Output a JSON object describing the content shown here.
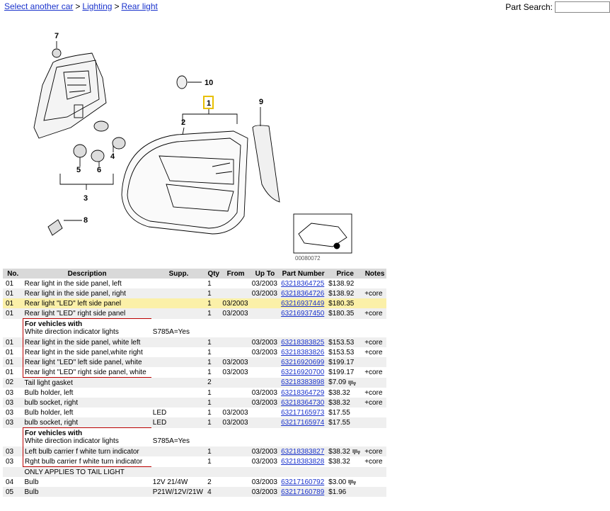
{
  "breadcrumb": {
    "items": [
      "Select another car",
      "Lighting",
      "Rear light"
    ],
    "separator": ">"
  },
  "search": {
    "label": "Part Search:",
    "value": ""
  },
  "diagram": {
    "callouts": [
      "7",
      "10",
      "1",
      "9",
      "2",
      "5",
      "6",
      "4",
      "3",
      "8"
    ],
    "thumb_code": "00080072"
  },
  "table": {
    "headers": [
      "No.",
      "Description",
      "Supp.",
      "Qty",
      "From",
      "Up To",
      "Part Number",
      "Price",
      "Notes"
    ],
    "rows": [
      {
        "no": "01",
        "desc": "Rear light in the side panel, left",
        "supp": "",
        "qty": "1",
        "from": "",
        "upto": "03/2003",
        "pn": "63218364725",
        "price": "$138.92",
        "notes": ""
      },
      {
        "no": "01",
        "desc": "Rear light in the side panel, right",
        "supp": "",
        "qty": "1",
        "from": "",
        "upto": "03/2003",
        "pn": "63218364726",
        "price": "$138.92",
        "notes": "+core"
      },
      {
        "no": "01",
        "desc": "Rear light \"LED\" left side panel",
        "supp": "",
        "qty": "1",
        "from": "03/2003",
        "upto": "",
        "pn": "63216937449",
        "price": "$180.35",
        "notes": ""
      },
      {
        "no": "01",
        "desc": "Rear light \"LED\" right side panel",
        "supp": "",
        "qty": "1",
        "from": "03/2003",
        "upto": "",
        "pn": "63216937450",
        "price": "$180.35",
        "notes": "+core"
      },
      {
        "note_title": "For vehicles with",
        "note_text": "White direction indicator lights",
        "note_code": "S785A=Yes"
      },
      {
        "no": "01",
        "desc": "Rear light in the side panel, white left",
        "supp": "",
        "qty": "1",
        "from": "",
        "upto": "03/2003",
        "pn": "63218383825",
        "price": "$153.53",
        "notes": "+core"
      },
      {
        "no": "01",
        "desc": "Rear light in the side panel,white right",
        "supp": "",
        "qty": "1",
        "from": "",
        "upto": "03/2003",
        "pn": "63218383826",
        "price": "$153.53",
        "notes": "+core"
      },
      {
        "no": "01",
        "desc": "Rear light \"LED\" left side panel, white",
        "supp": "",
        "qty": "1",
        "from": "03/2003",
        "upto": "",
        "pn": "63216920699",
        "price": "$199.17",
        "notes": ""
      },
      {
        "no": "01",
        "desc": "Rear light \"LED\" right side panel, white",
        "supp": "",
        "qty": "1",
        "from": "03/2003",
        "upto": "",
        "pn": "63216920700",
        "price": "$199.17",
        "notes": "+core"
      },
      {
        "no": "02",
        "desc": "Tail light gasket",
        "supp": "",
        "qty": "2",
        "from": "",
        "upto": "",
        "pn": "63218383898",
        "price": "$7.09",
        "notes": ""
      },
      {
        "no": "03",
        "desc": "Bulb holder, left",
        "supp": "",
        "qty": "1",
        "from": "",
        "upto": "03/2003",
        "pn": "63218364729",
        "price": "$38.32",
        "notes": "+core"
      },
      {
        "no": "03",
        "desc": "bulb socket, right",
        "supp": "",
        "qty": "1",
        "from": "",
        "upto": "03/2003",
        "pn": "63218364730",
        "price": "$38.32",
        "notes": "+core"
      },
      {
        "no": "03",
        "desc": "Bulb holder, left",
        "supp": "LED",
        "qty": "1",
        "from": "03/2003",
        "upto": "",
        "pn": "63217165973",
        "price": "$17.55",
        "notes": ""
      },
      {
        "no": "03",
        "desc": "bulb socket, right",
        "supp": "LED",
        "qty": "1",
        "from": "03/2003",
        "upto": "",
        "pn": "63217165974",
        "price": "$17.55",
        "notes": ""
      },
      {
        "note_title": "For vehicles with",
        "note_text": "White direction indicator lights",
        "note_code": "S785A=Yes"
      },
      {
        "no": "03",
        "desc": "Left bulb carrier f white turn indicator",
        "supp": "",
        "qty": "1",
        "from": "",
        "upto": "03/2003",
        "pn": "63218383827",
        "price": "$38.32",
        "notes": "+core"
      },
      {
        "no": "03",
        "desc": "Rght bulb carrier f white turn indicator",
        "supp": "",
        "qty": "1",
        "from": "",
        "upto": "03/2003",
        "pn": "63218383828",
        "price": "$38.32",
        "notes": "+core"
      },
      {
        "only_text": "ONLY APPLIES TO TAIL LIGHT"
      },
      {
        "no": "04",
        "desc": "Bulb",
        "supp": "12V 21/4W",
        "qty": "2",
        "from": "",
        "upto": "03/2003",
        "pn": "63217160792",
        "price": "$3.00",
        "notes": ""
      },
      {
        "no": "05",
        "desc": "Bulb",
        "supp": "P21W/12V/21W",
        "qty": "4",
        "from": "",
        "upto": "03/2003",
        "pn": "63217160789",
        "price": "$1.96",
        "notes": ""
      }
    ]
  },
  "colors": {
    "link": "#1a33cc",
    "highlight_row": "#fbf0a8",
    "alt_row": "#efefef",
    "header": "#d9d9d9",
    "bracket": "#bb0000"
  }
}
